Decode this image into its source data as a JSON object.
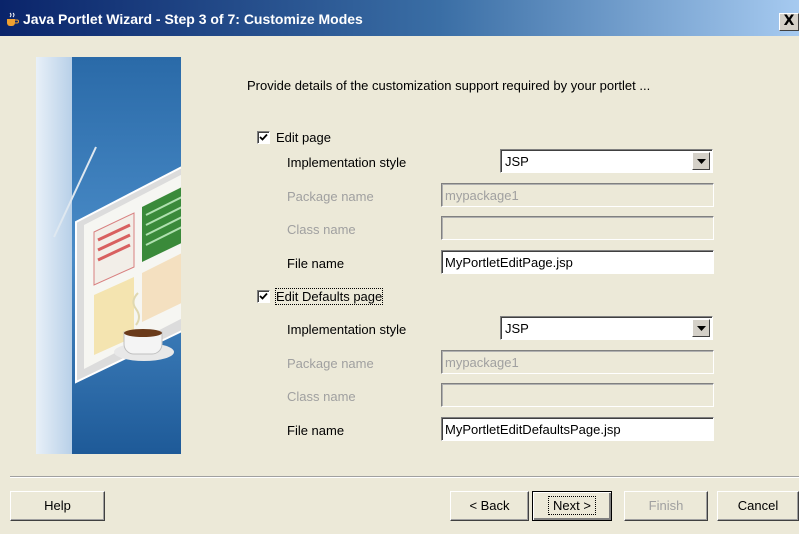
{
  "window": {
    "title": "Java Portlet Wizard - Step 3 of 7: Customize Modes",
    "close_glyph": "X",
    "icon": "java-cup-icon"
  },
  "intro": "Provide details of the customization support required by your portlet ...",
  "edit_page": {
    "checkbox_label": "Edit page",
    "checked": true,
    "implementation_label": "Implementation style",
    "implementation_value": "JSP",
    "package_label": "Package name",
    "package_value": "mypackage1",
    "class_label": "Class name",
    "class_value": "",
    "file_label": "File name",
    "file_value": "MyPortletEditPage.jsp"
  },
  "edit_defaults_page": {
    "checkbox_label": "Edit Defaults page",
    "checked": true,
    "implementation_label": "Implementation style",
    "implementation_value": "JSP",
    "package_label": "Package name",
    "package_value": "mypackage1",
    "class_label": "Class name",
    "class_value": "",
    "file_label": "File name",
    "file_value": "MyPortletEditDefaultsPage.jsp"
  },
  "buttons": {
    "help": "Help",
    "back": "< Back",
    "next": "Next >",
    "finish": "Finish",
    "cancel": "Cancel"
  },
  "colors": {
    "title_start": "#0a246a",
    "title_end": "#a6caf0",
    "dialog_bg": "#ece9d8",
    "disabled_text": "#a0a0a0"
  }
}
